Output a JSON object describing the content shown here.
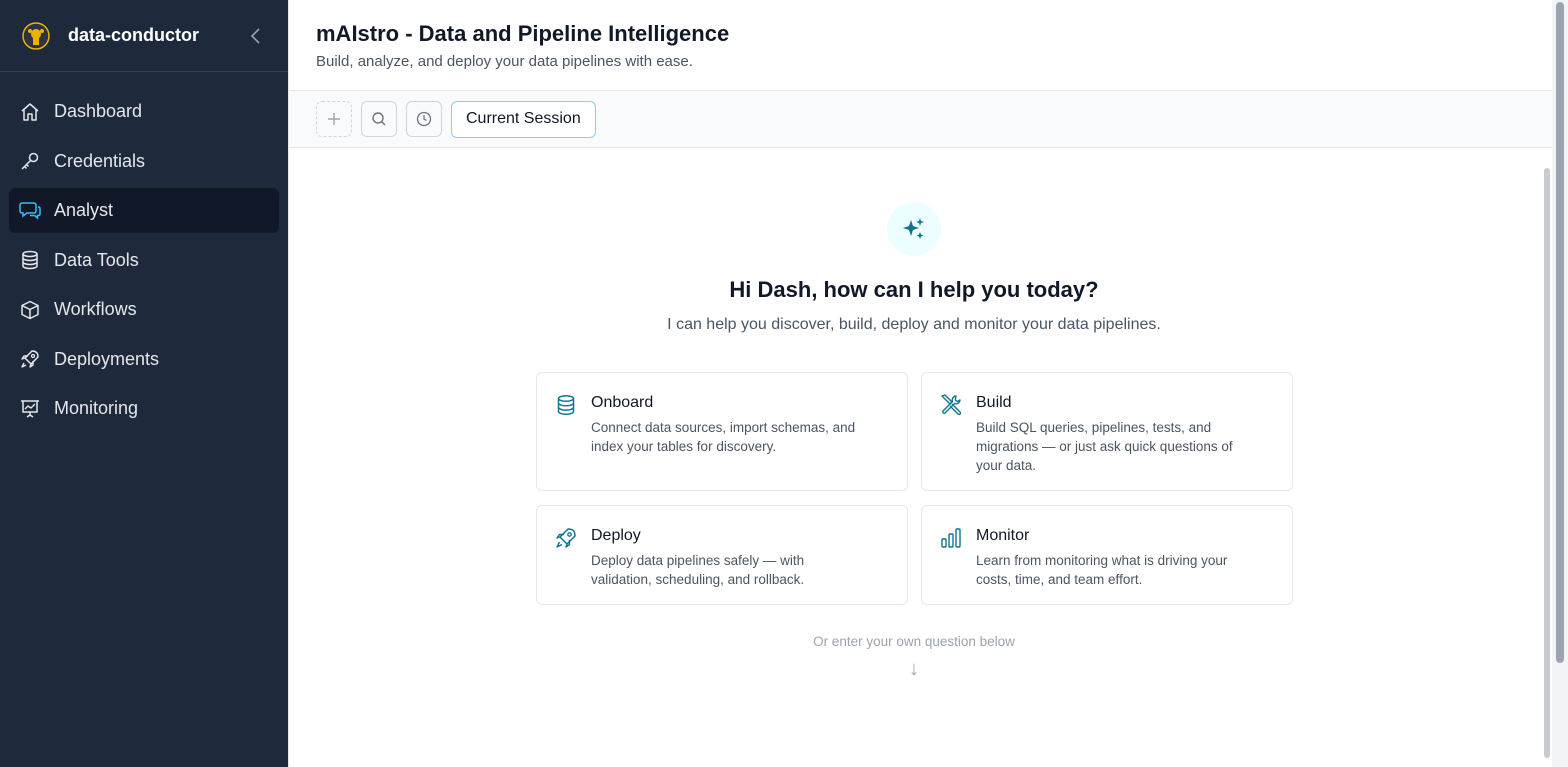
{
  "sidebar": {
    "app_name": "data-conductor",
    "items": [
      {
        "label": "Dashboard",
        "icon": "home-icon",
        "active": false
      },
      {
        "label": "Credentials",
        "icon": "key-icon",
        "active": false
      },
      {
        "label": "Analyst",
        "icon": "chat-icon",
        "active": true
      },
      {
        "label": "Data Tools",
        "icon": "database-icon",
        "active": false
      },
      {
        "label": "Workflows",
        "icon": "cube-icon",
        "active": false
      },
      {
        "label": "Deployments",
        "icon": "rocket-icon",
        "active": false
      },
      {
        "label": "Monitoring",
        "icon": "presentation-chart-icon",
        "active": false
      }
    ]
  },
  "header": {
    "title": "mAIstro - Data and Pipeline Intelligence",
    "subtitle": "Build, analyze, and deploy your data pipelines with ease."
  },
  "toolbar": {
    "session_tab": "Current Session"
  },
  "welcome": {
    "greeting": "Hi Dash, how can I help you today?",
    "subtitle": "I can help you discover, build, deploy and monitor your data pipelines.",
    "hint": "Or enter your own question below",
    "hint_arrow": "↓"
  },
  "cards": [
    {
      "title": "Onboard",
      "description": "Connect data sources, import schemas, and index your tables for discovery.",
      "icon": "database-icon"
    },
    {
      "title": "Build",
      "description": "Build SQL queries, pipelines, tests, and migrations — or just ask quick questions of your data.",
      "icon": "wrench-screwdriver-icon"
    },
    {
      "title": "Deploy",
      "description": "Deploy data pipelines safely — with validation, scheduling, and rollback.",
      "icon": "rocket-icon"
    },
    {
      "title": "Monitor",
      "description": "Learn from monitoring what is driving your costs, time, and team effort.",
      "icon": "bar-chart-icon"
    }
  ],
  "colors": {
    "sidebar_bg": "#1e2a3b",
    "accent": "#0e7490",
    "active_item_bg": "#111827"
  }
}
